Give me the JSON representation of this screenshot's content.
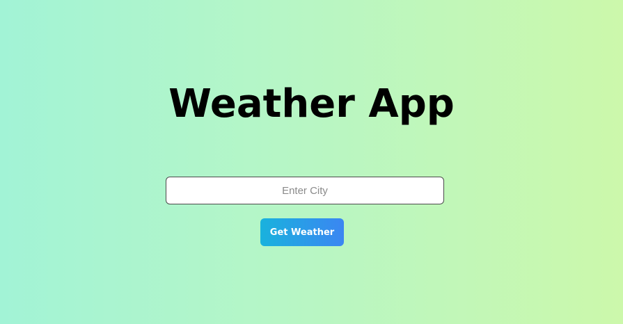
{
  "app": {
    "title": "Weather App"
  },
  "search": {
    "placeholder": "Enter City",
    "value": ""
  },
  "actions": {
    "get_weather_label": "Get Weather"
  },
  "colors": {
    "background_start": "#a2f3d6",
    "background_end": "#ccf8ab",
    "button_start": "#19b2dd",
    "button_end": "#3b86f2",
    "title": "#000000"
  }
}
